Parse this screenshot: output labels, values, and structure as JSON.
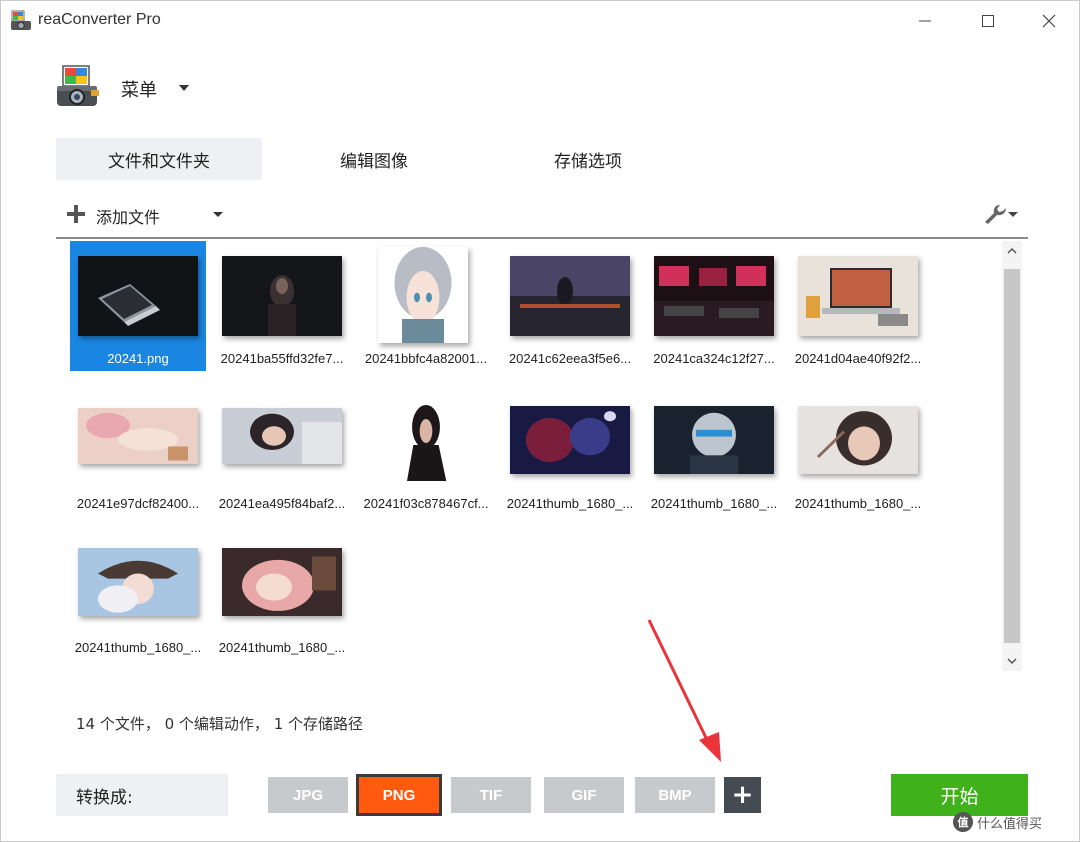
{
  "window": {
    "title": "reaConverter Pro"
  },
  "menu": {
    "label": "菜单"
  },
  "tabs": [
    {
      "label": "文件和文件夹",
      "active": true
    },
    {
      "label": "编辑图像",
      "active": false
    },
    {
      "label": "存储选项",
      "active": false
    }
  ],
  "toolbar": {
    "add_files_label": "添加文件",
    "icons": [
      "plus-icon",
      "chevron-down-icon",
      "wrench-icon"
    ]
  },
  "files": [
    {
      "name": "20241.png",
      "selected": true
    },
    {
      "name": "20241ba55ffd32fe7...",
      "selected": false
    },
    {
      "name": "20241bbfc4a82001...",
      "selected": false
    },
    {
      "name": "20241c62eea3f5e6...",
      "selected": false
    },
    {
      "name": "20241ca324c12f27...",
      "selected": false
    },
    {
      "name": "20241d04ae40f92f2...",
      "selected": false
    },
    {
      "name": "20241e97dcf82400...",
      "selected": false
    },
    {
      "name": "20241ea495f84baf2...",
      "selected": false
    },
    {
      "name": "20241f03c878467cf...",
      "selected": false
    },
    {
      "name": "20241thumb_1680_...",
      "selected": false
    },
    {
      "name": "20241thumb_1680_...",
      "selected": false
    },
    {
      "name": "20241thumb_1680_...",
      "selected": false
    },
    {
      "name": "20241thumb_1680_...",
      "selected": false
    },
    {
      "name": "20241thumb_1680_...",
      "selected": false
    }
  ],
  "status": {
    "text": "14 个文件， 0 个编辑动作， 1 个存储路径"
  },
  "bottom": {
    "convert_label": "转换成:",
    "formats": [
      "JPG",
      "PNG",
      "TIF",
      "GIF",
      "BMP"
    ],
    "selected_format": "PNG",
    "add_format_label": "+",
    "start_label": "开始"
  },
  "colors": {
    "selected_tile": "#1a86e2",
    "active_format": "#ff5a10",
    "start_button": "#3fb21b",
    "annotation_arrow": "#e8343a"
  },
  "watermark": {
    "icon_text": "值",
    "text": "什么值得买"
  }
}
